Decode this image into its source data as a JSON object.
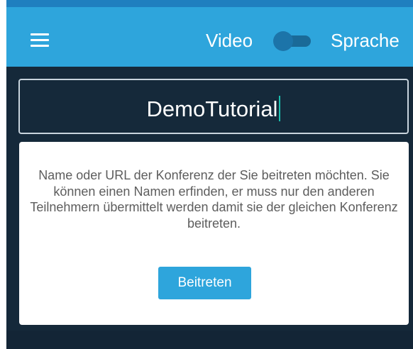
{
  "toolbar": {
    "menu_icon": "hamburger-menu-icon",
    "video_label": "Video",
    "language_label": "Sprache",
    "toggle_state": "off"
  },
  "room": {
    "value": "DemoTutorial"
  },
  "card": {
    "description": "Name oder URL der Konferenz der Sie beitreten möchten. Sie können einen Namen erfinden, er muss nur den anderen Teilnehmern übermittelt werden damit sie der gleichen Konferenz beitreten.",
    "join_label": "Beitreten"
  },
  "colors": {
    "toolbar": "#2ea5dc",
    "background": "#15293a",
    "button": "#2ea5dc",
    "caret": "#1bbfae"
  }
}
